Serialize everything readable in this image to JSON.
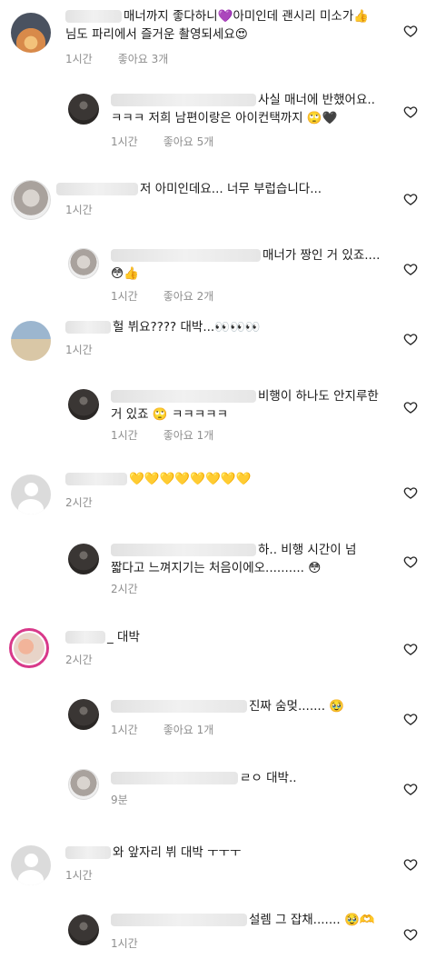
{
  "comments": [
    {
      "text": "매너까지 좋다하니💜아미인데 괜시리 미소가👍\n님도 파리에서 즐거운 촬영되세요😍",
      "time": "1시간",
      "likes": "좋아요 3개"
    },
    {
      "text": "사실 매너에 반했어요..\nㅋㅋㅋ 저희 남편이랑은 아이컨택까지 🙄🖤",
      "time": "1시간",
      "likes": "좋아요 5개"
    },
    {
      "text": "저 아미인데요... 너무 부럽습니다...",
      "time": "1시간",
      "likes": ""
    },
    {
      "text": "매너가 짱인 거 있죠....\n😳👍",
      "time": "1시간",
      "likes": "좋아요 2개"
    },
    {
      "text": "헐 뷔요???? 대박...👀👀👀",
      "time": "1시간",
      "likes": ""
    },
    {
      "text": "비행이 하나도 안지루한\n거 있죠 🙄 ㅋㅋㅋㅋㅋ",
      "time": "1시간",
      "likes": "좋아요 1개"
    },
    {
      "text": "💛💛💛💛💛💛💛💛",
      "time": "2시간",
      "likes": ""
    },
    {
      "text": "하.. 비행 시간이 넘\n짧다고 느껴지기는 처음이에오.......... 😳",
      "time": "2시간",
      "likes": ""
    },
    {
      "text": "_ 대박",
      "time": "2시간",
      "likes": ""
    },
    {
      "text": "진짜 숨멎....... 🥹",
      "time": "1시간",
      "likes": "좋아요 1개"
    },
    {
      "text": "ㄹㅇ 대박..",
      "time": "9분",
      "likes": ""
    },
    {
      "text": "와 앞자리 뷔 대박 ㅜㅜㅜ",
      "time": "1시간",
      "likes": ""
    },
    {
      "text": "설렘 그 잡채....... 🥹🫶",
      "time": "1시간",
      "likes": ""
    }
  ]
}
